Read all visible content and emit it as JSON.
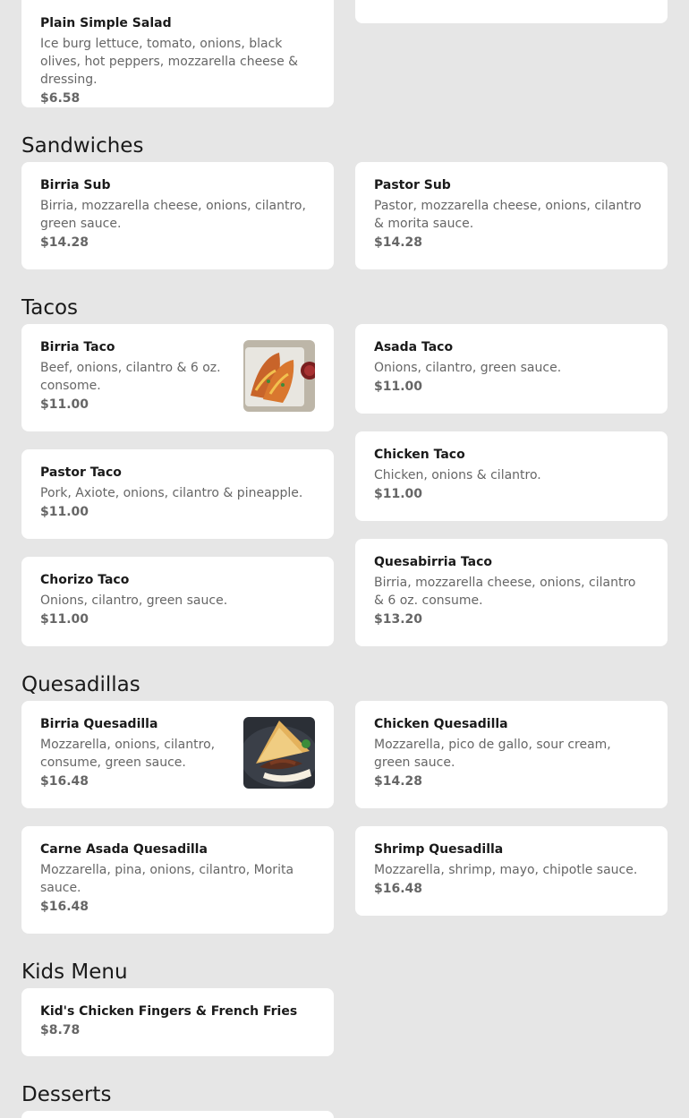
{
  "sections": {
    "sandwiches": "Sandwiches",
    "tacos": "Tacos",
    "quesadillas": "Quesadillas",
    "kids": "Kids Menu",
    "desserts": "Desserts"
  },
  "items": {
    "salad": {
      "name": "Plain Simple Salad",
      "desc": "Ice burg lettuce, tomato, onions, black olives, hot peppers, mozzarella cheese & dressing.",
      "price": "$6.58"
    },
    "birria_sub": {
      "name": "Birria Sub",
      "desc": "Birria, mozzarella cheese, onions, cilantro, green sauce.",
      "price": "$14.28"
    },
    "pastor_sub": {
      "name": "Pastor Sub",
      "desc": "Pastor, mozzarella cheese, onions, cilantro & morita sauce.",
      "price": "$14.28"
    },
    "birria_taco": {
      "name": "Birria Taco",
      "desc": "Beef, onions, cilantro & 6 oz. consome.",
      "price": "$11.00"
    },
    "asada_taco": {
      "name": "Asada Taco",
      "desc": "Onions, cilantro, green sauce.",
      "price": "$11.00"
    },
    "chicken_taco": {
      "name": "Chicken Taco",
      "desc": "Chicken, onions & cilantro.",
      "price": "$11.00"
    },
    "pastor_taco": {
      "name": "Pastor Taco",
      "desc": "Pork, Axiote, onions, cilantro & pineapple.",
      "price": "$11.00"
    },
    "quesabirria_taco": {
      "name": "Quesabirria Taco",
      "desc": "Birria, mozzarella cheese, onions, cilantro & 6 oz. consume.",
      "price": "$13.20"
    },
    "chorizo_taco": {
      "name": "Chorizo Taco",
      "desc": "Onions, cilantro, green sauce.",
      "price": "$11.00"
    },
    "birria_quesadilla": {
      "name": "Birria Quesadilla",
      "desc": "Mozzarella, onions, cilantro, consume, green sauce.",
      "price": "$16.48"
    },
    "chicken_quesadilla": {
      "name": "Chicken Quesadilla",
      "desc": "Mozzarella, pico de gallo, sour cream, green sauce.",
      "price": "$14.28"
    },
    "carne_asada_quesadilla": {
      "name": "Carne Asada Quesadilla",
      "desc": "Mozzarella, pina, onions, cilantro, Morita sauce.",
      "price": "$16.48"
    },
    "shrimp_quesadilla": {
      "name": "Shrimp Quesadilla",
      "desc": "Mozzarella, shrimp, mayo, chipotle sauce.",
      "price": "$16.48"
    },
    "kids_fingers": {
      "name": "Kid's Chicken Fingers & French Fries",
      "price": "$8.78"
    }
  }
}
